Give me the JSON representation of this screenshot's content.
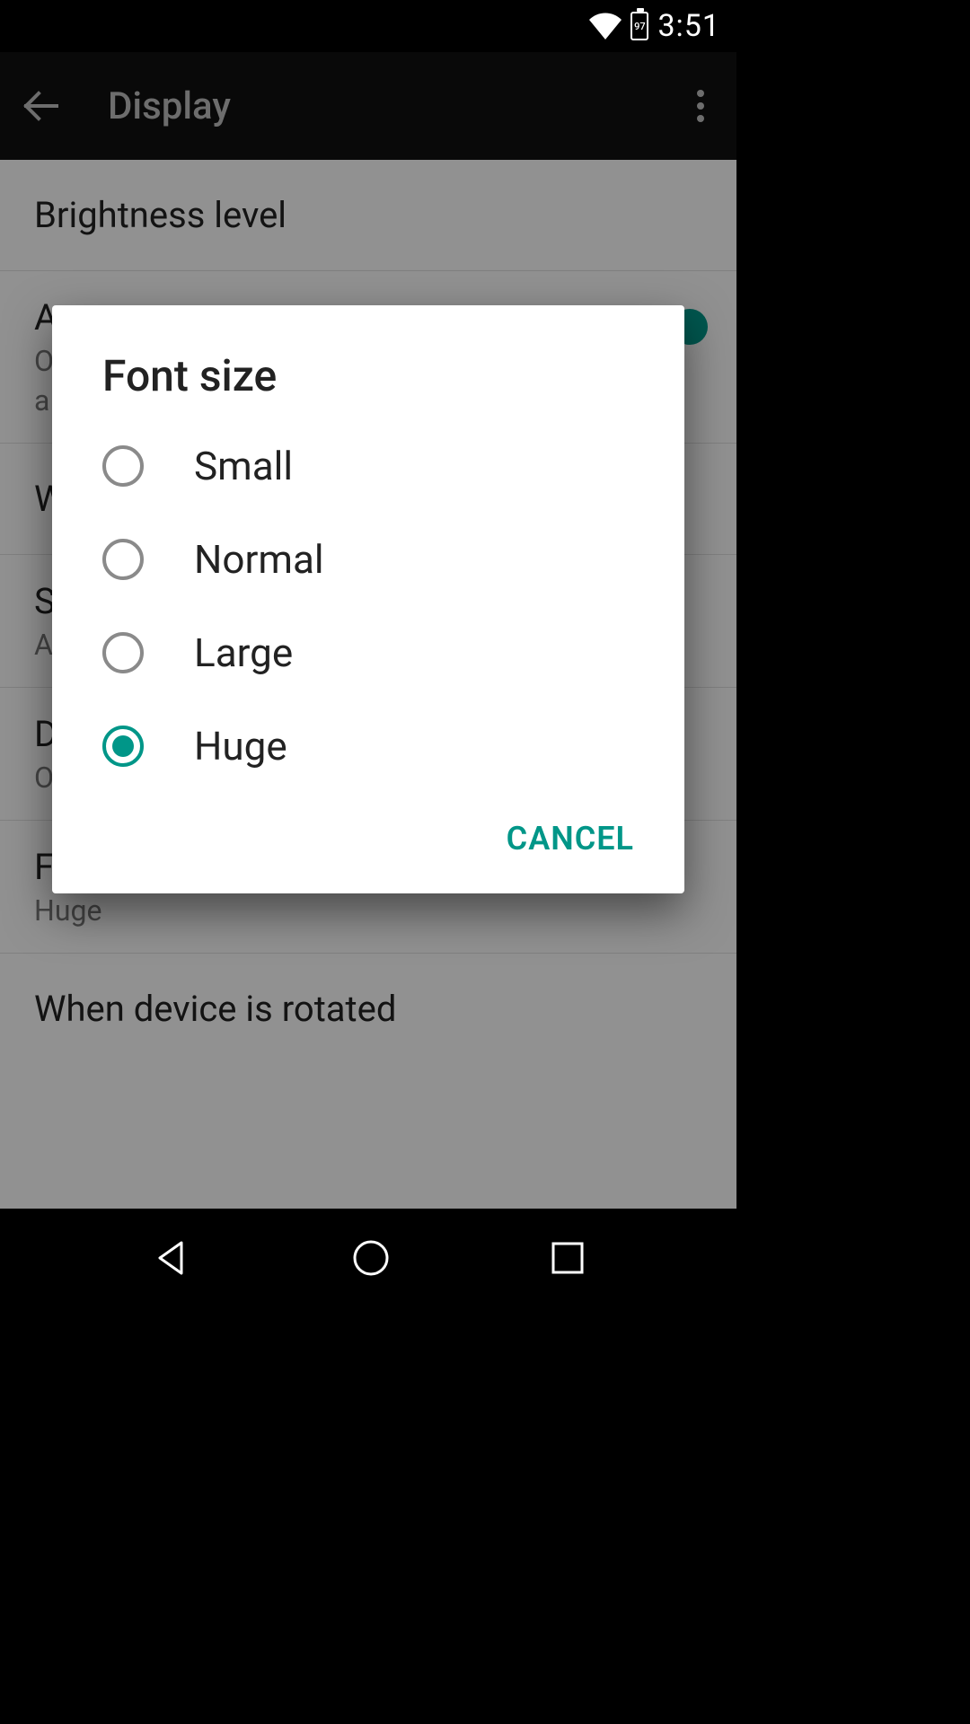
{
  "status_bar": {
    "battery_level": "97",
    "time": "3:51"
  },
  "app_bar": {
    "title": "Display"
  },
  "settings": {
    "brightness_label": "Brightness level",
    "adaptive_label": "A",
    "adaptive_sub1": "O",
    "adaptive_sub2": "a",
    "wallpaper_label": "W",
    "sleep_label": "S",
    "sleep_sub": "A",
    "daydream_label": "D",
    "daydream_sub": "O",
    "font_size_label": "Font size",
    "font_size_value": "Huge",
    "rotation_label": "When device is rotated"
  },
  "dialog": {
    "title": "Font size",
    "options": [
      {
        "label": "Small",
        "selected": false
      },
      {
        "label": "Normal",
        "selected": false
      },
      {
        "label": "Large",
        "selected": false
      },
      {
        "label": "Huge",
        "selected": true
      }
    ],
    "cancel_label": "CANCEL"
  },
  "colors": {
    "accent": "#009688"
  }
}
